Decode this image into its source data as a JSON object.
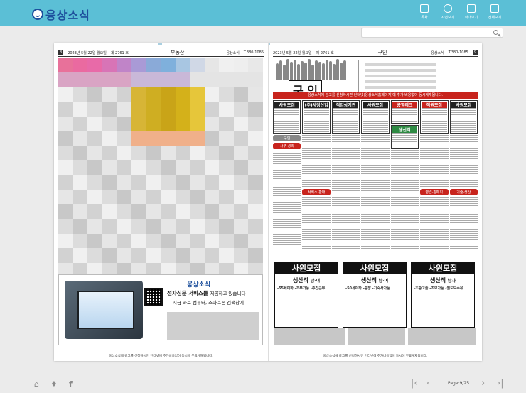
{
  "app": {
    "title": "웅상소식"
  },
  "toolbar": {
    "items": [
      {
        "label": "목차",
        "icon": "toc-icon"
      },
      {
        "label": "지면보기",
        "icon": "view-icon"
      },
      {
        "label": "확대보기",
        "icon": "zoom-icon"
      },
      {
        "label": "전체보기",
        "icon": "grid-icon"
      }
    ]
  },
  "search": {
    "placeholder": ""
  },
  "left_page": {
    "page_number": "8",
    "date": "2023년 5월 22일 월요일",
    "issue": "제 2761 호",
    "section": "부동산",
    "paper_name": "웅상소식",
    "phone": "T.380-1085",
    "ad": {
      "logo": "웅상소식",
      "line1_bold": "전자신문 서비스를",
      "line1_rest": "제공하고 있습니다",
      "line2": "지금 바로 컴퓨터, 스마트폰 검색창에"
    },
    "footer": "웅상소식에 광고를 신청하시면 인터넷에 추가비용없이 동시에 무료게재됩니다."
  },
  "right_page": {
    "page_number": "9",
    "date": "2023년 5월 22일 월요일",
    "issue": "제 2761 호",
    "section": "구인",
    "paper_name": "웅상소식",
    "phone": "T.380-1085",
    "banner_title": "구 인",
    "red_bar": "웅상소식에 광고를 신청하시면 인터넷(웅상소식홈페이지)에 추가 비용없이 동시게재됩니다.",
    "col_headers": [
      "사원모집",
      "(주)세정산업",
      "직업상기관",
      "사원모집",
      "공영테크",
      "직원모집",
      "사원모집"
    ],
    "tags": [
      "구인",
      "사무·경리",
      "서비스·판매",
      "생산직",
      "영업·판매직",
      "기술·생산"
    ],
    "recruit": [
      {
        "title": "사원모집",
        "main": "생산직",
        "sub": "남·여",
        "note": "-55세이하 -조부가능 -주간근무"
      },
      {
        "title": "사원모집",
        "main": "생산직",
        "sub": "남·여",
        "note": "-50세이하 -중장 -기숙사가능"
      },
      {
        "title": "사원모집",
        "main": "생산직",
        "sub": "남자",
        "note": "-조중고졸 -초보가능 -월도보수유"
      }
    ],
    "footer": "웅상소식에 광고를 신청하시면 인터넷에 추가비용없이 동시에 무료게재됩니다."
  },
  "bottom": {
    "pager": "Page:9/25"
  },
  "colors": {
    "topbar": "#5bbfd6",
    "brand": "#1d4f9c",
    "accent_red": "#c8241d"
  }
}
